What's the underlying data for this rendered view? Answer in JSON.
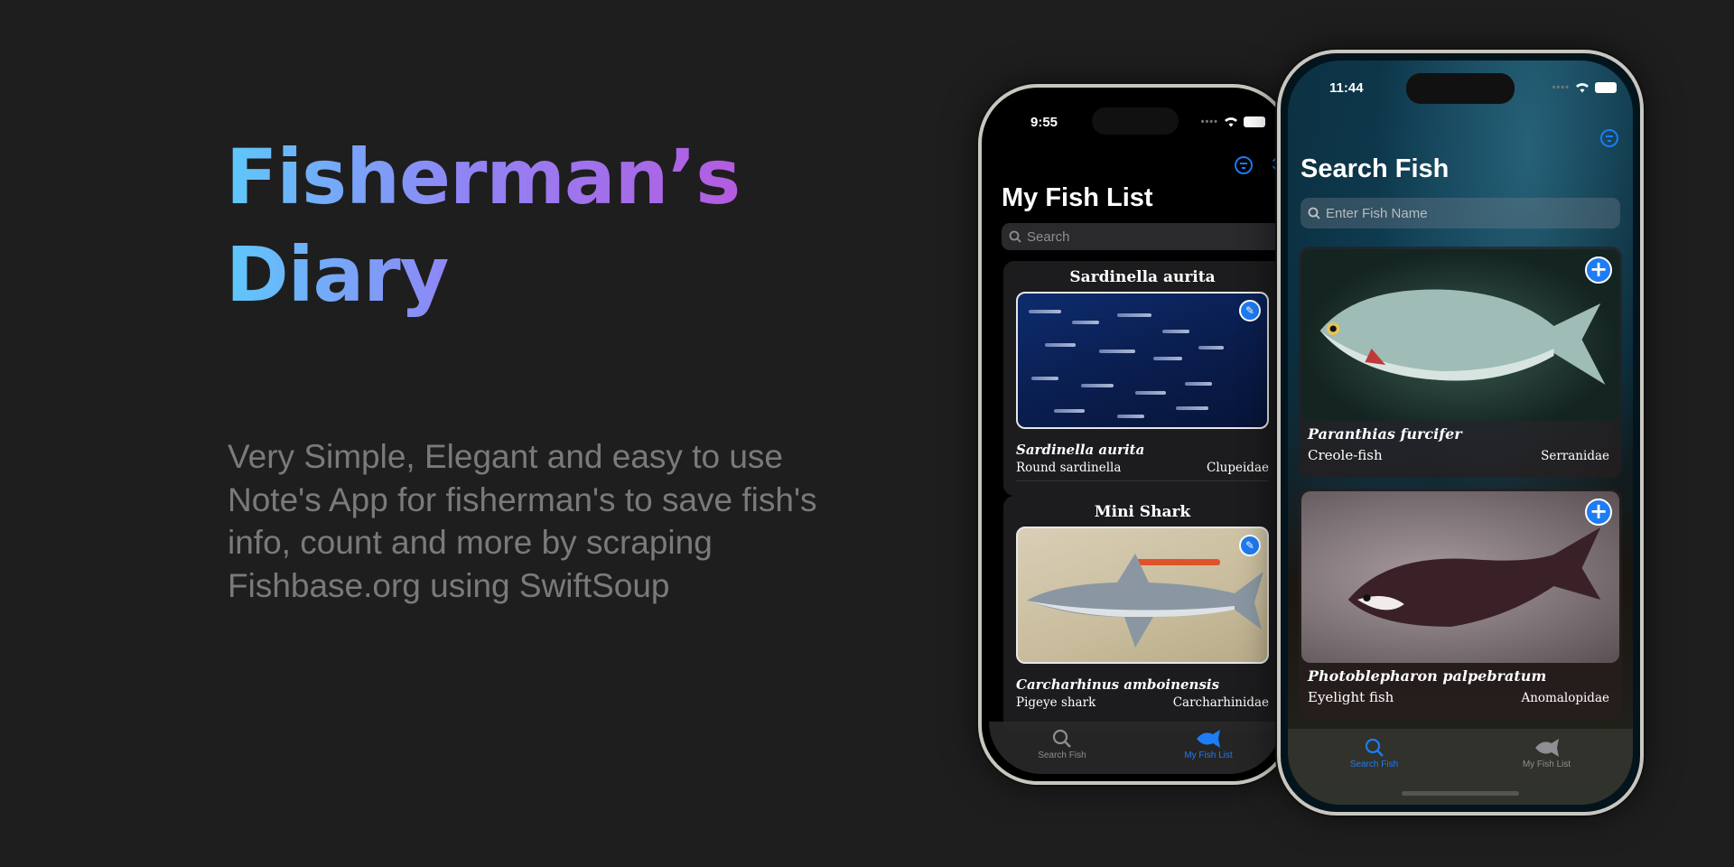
{
  "hero": {
    "title_line1": "Fisherman’s",
    "title_line2": "Diary",
    "subtitle": "Very Simple, Elegant and easy to use Note's App for fisherman's to save fish's info, count and more by scraping Fishbase.org using SwiftSoup"
  },
  "left_phone": {
    "time": "9:55",
    "title": "My Fish List",
    "search_placeholder": "Search",
    "items": [
      {
        "header": "Sardinella aurita",
        "scientific": "Sardinella aurita",
        "common": "Round sardinella",
        "family": "Clupeidae"
      },
      {
        "header": "Mini Shark",
        "scientific": "Carcharhinus amboinensis",
        "common": "Pigeye shark",
        "family": "Carcharhinidae"
      }
    ],
    "tabs": [
      {
        "label": "Search Fish",
        "icon": "magnifier-icon",
        "active": false
      },
      {
        "label": "My Fish List",
        "icon": "fish-icon",
        "active": true
      }
    ]
  },
  "right_phone": {
    "time": "11:44",
    "title": "Search Fish",
    "search_placeholder": "Enter Fish Name",
    "items": [
      {
        "scientific": "Paranthias furcifer",
        "common": "Creole-fish",
        "family": "Serranidae"
      },
      {
        "scientific": "Photoblepharon palpebratum",
        "common": "Eyelight fish",
        "family": "Anomalopidae"
      }
    ],
    "tabs": [
      {
        "label": "Search Fish",
        "icon": "magnifier-icon",
        "active": true
      },
      {
        "label": "My Fish List",
        "icon": "fish-icon",
        "active": false
      }
    ]
  },
  "colors": {
    "accent": "#1e7cf5",
    "gradient_start": "#5ec8fb",
    "gradient_end": "#b45be0",
    "subtitle_text": "#7a7a7a"
  }
}
